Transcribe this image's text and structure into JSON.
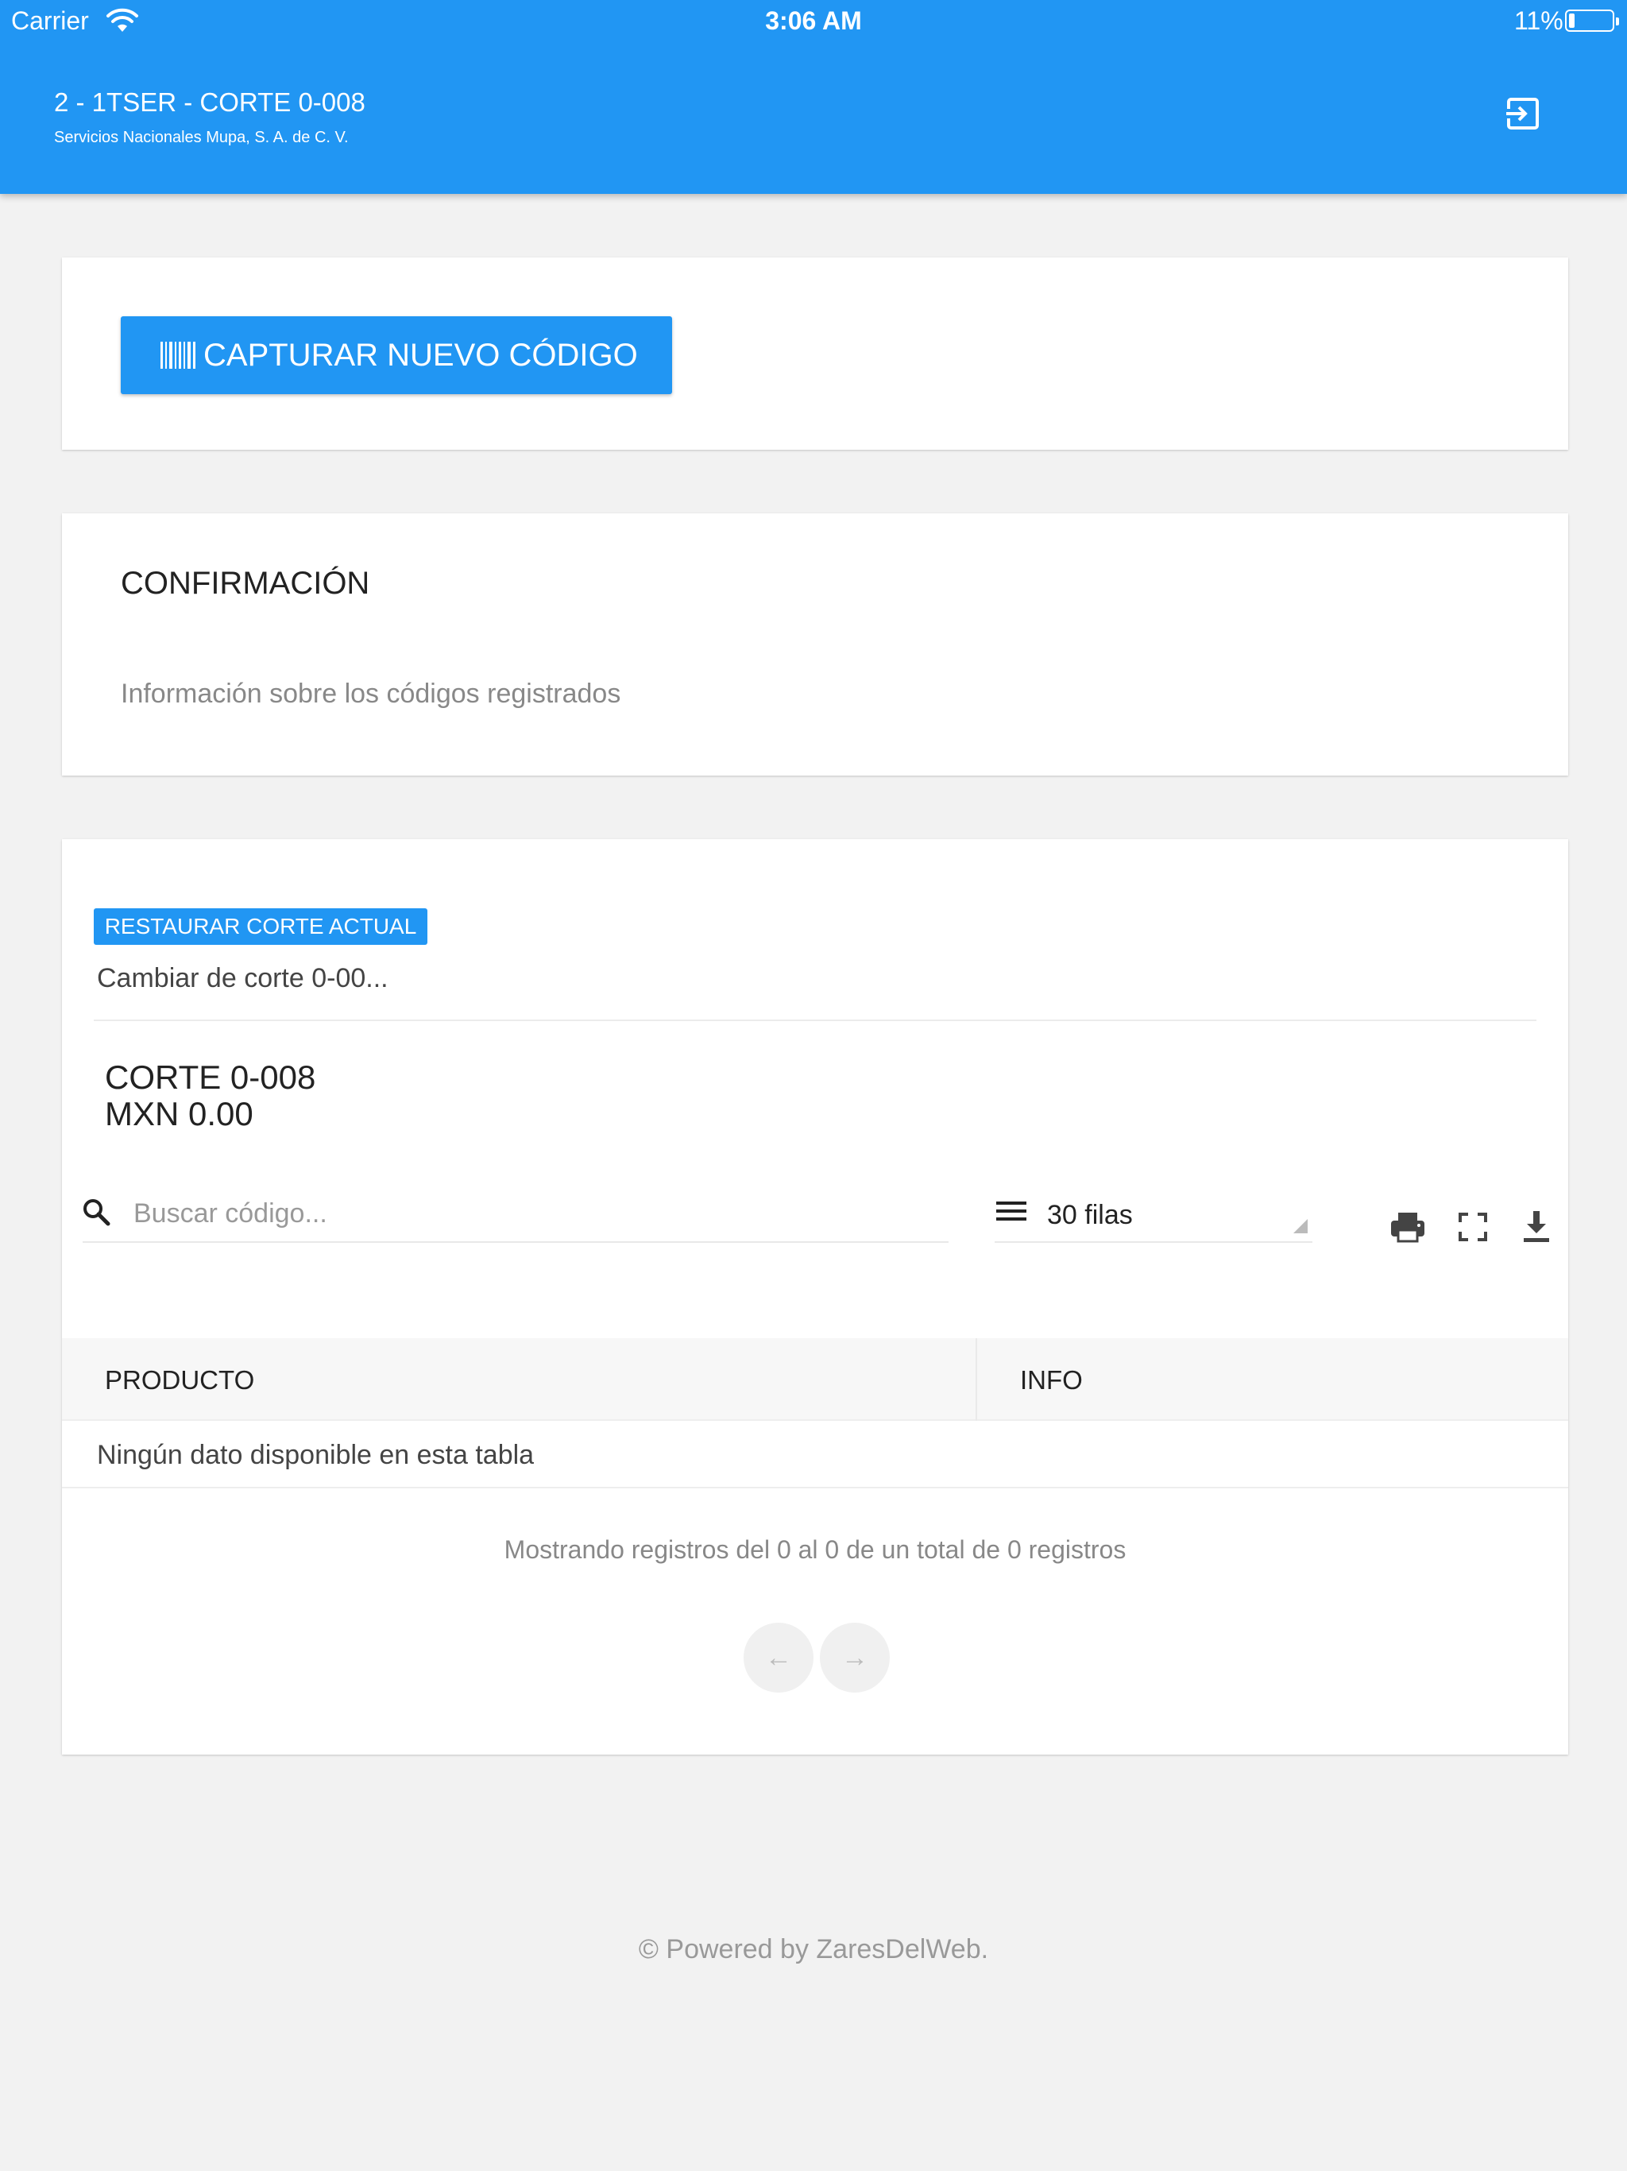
{
  "status_bar": {
    "carrier": "Carrier",
    "time": "3:06 AM",
    "battery": "11%"
  },
  "header": {
    "title": "2 - 1TSER - CORTE 0-008",
    "subtitle": "Servicios Nacionales Mupa, S. A. de C. V.",
    "exit_icon": "exit-to-app-icon",
    "color": "#2196f3"
  },
  "capture": {
    "button_label": "CAPTURAR NUEVO CÓDIGO",
    "icon": "barcode-icon"
  },
  "confirmation": {
    "title": "CONFIRMACIÓN",
    "text": "Información sobre los códigos registrados"
  },
  "corte": {
    "restore_label": "RESTAURAR CORTE ACTUAL",
    "change_label": "Cambiar de corte 0-00...",
    "name": "CORTE 0-008",
    "amount": "MXN 0.00"
  },
  "search": {
    "placeholder": "Buscar código...",
    "value": ""
  },
  "rows": {
    "label": "30 filas"
  },
  "toolbar": {
    "icons": [
      "print-icon",
      "fullscreen-icon",
      "download-icon"
    ]
  },
  "table": {
    "columns": [
      "PRODUCTO",
      "INFO"
    ],
    "empty_message": "Ningún dato disponible en esta tabla",
    "info": "Mostrando registros del 0 al 0 de un total de 0 registros"
  },
  "pagination": {
    "prev": "←",
    "next": "→"
  },
  "footer": {
    "text": "© Powered by ZaresDelWeb."
  }
}
